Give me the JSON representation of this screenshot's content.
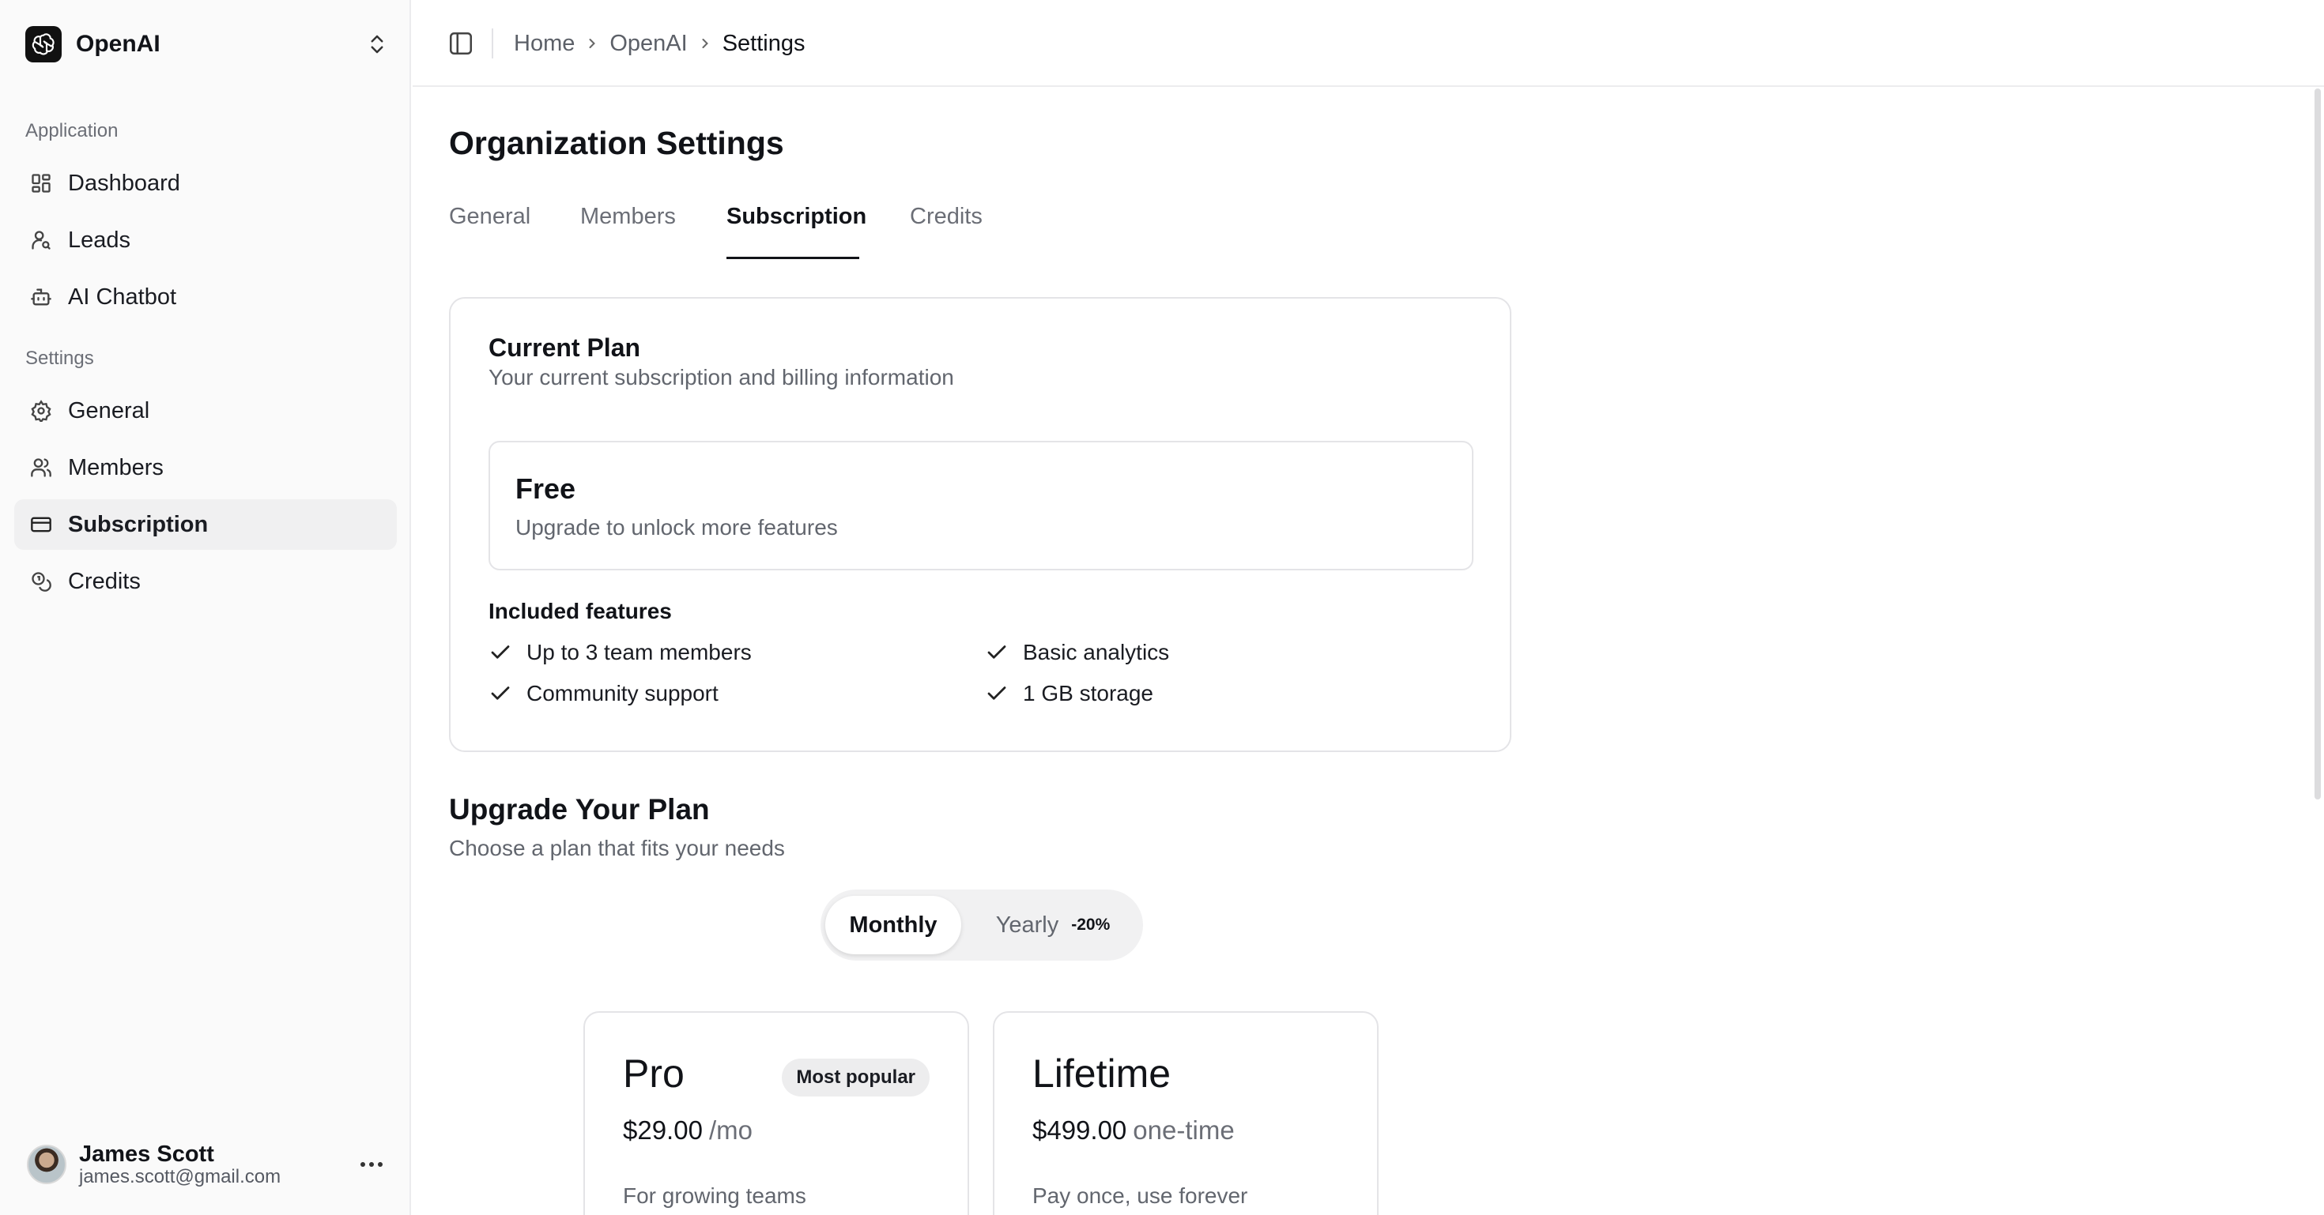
{
  "org": {
    "name": "OpenAI"
  },
  "sidebar": {
    "groups": [
      {
        "label": "Application",
        "items": [
          {
            "label": "Dashboard",
            "icon": "dashboard-icon"
          },
          {
            "label": "Leads",
            "icon": "user-search-icon"
          },
          {
            "label": "AI Chatbot",
            "icon": "bot-icon"
          }
        ]
      },
      {
        "label": "Settings",
        "items": [
          {
            "label": "General",
            "icon": "gear-icon"
          },
          {
            "label": "Members",
            "icon": "users-icon"
          },
          {
            "label": "Subscription",
            "icon": "credit-card-icon",
            "active": true
          },
          {
            "label": "Credits",
            "icon": "coins-icon"
          }
        ]
      }
    ]
  },
  "user": {
    "name": "James Scott",
    "email": "james.scott@gmail.com"
  },
  "breadcrumb": [
    "Home",
    "OpenAI",
    "Settings"
  ],
  "page": {
    "title": "Organization Settings",
    "tabs": [
      {
        "label": "General"
      },
      {
        "label": "Members"
      },
      {
        "label": "Subscription",
        "active": true
      },
      {
        "label": "Credits"
      }
    ]
  },
  "current_plan": {
    "title": "Current Plan",
    "subtitle": "Your current subscription and billing information",
    "plan_name": "Free",
    "plan_desc": "Upgrade to unlock more features",
    "features_label": "Included features",
    "features": [
      "Up to 3 team members",
      "Basic analytics",
      "Community support",
      "1 GB storage"
    ]
  },
  "upgrade": {
    "title": "Upgrade Your Plan",
    "subtitle": "Choose a plan that fits your needs",
    "billing": {
      "monthly": "Monthly",
      "yearly": "Yearly",
      "discount": "-20%",
      "selected": "Monthly"
    },
    "plans": [
      {
        "name": "Pro",
        "badge": "Most popular",
        "price": "$29.00",
        "period": "/mo",
        "desc": "For growing teams"
      },
      {
        "name": "Lifetime",
        "badge": "",
        "price": "$499.00",
        "period": "one-time",
        "desc": "Pay once, use forever"
      }
    ]
  },
  "colors": {
    "accent": "#111318",
    "muted": "#62666e",
    "border": "#e4e4e7",
    "sidebar_bg": "#fafafa"
  }
}
